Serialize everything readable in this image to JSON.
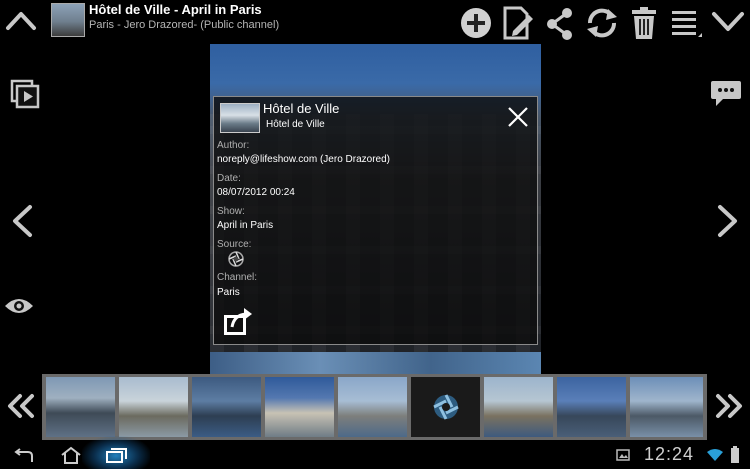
{
  "app": {
    "title": "Hôtel de Ville - April in Paris",
    "subtitle": "Paris - Jero Drazored- (Public channel)"
  },
  "toolbar": {
    "collapse_icon": "chevron-up-icon",
    "add_icon": "add-circle-icon",
    "edit_icon": "edit-icon",
    "share_icon": "share-icon",
    "refresh_icon": "refresh-icon",
    "delete_icon": "trash-icon",
    "menu_icon": "menu-lines-icon",
    "expand_icon": "chevron-down-icon"
  },
  "dialog": {
    "title": "Hôtel de Ville",
    "subtitle": "Hôtel de Ville",
    "author_label": "Author:",
    "author_value": "noreply@lifeshow.com (Jero Drazored)",
    "date_label": "Date:",
    "date_value": "08/07/2012 00:24",
    "show_label": "Show:",
    "show_value": "April in Paris",
    "source_label": "Source:",
    "channel_label": "Channel:",
    "channel_value": "Paris"
  },
  "filmstrip": {
    "count": 9,
    "selected_index": 5
  },
  "system": {
    "clock": "12:24"
  },
  "colors": {
    "accent": "#2a90d0",
    "filmstrip_border": "#6a6a6a",
    "icon_gray": "#c8c8c8"
  }
}
